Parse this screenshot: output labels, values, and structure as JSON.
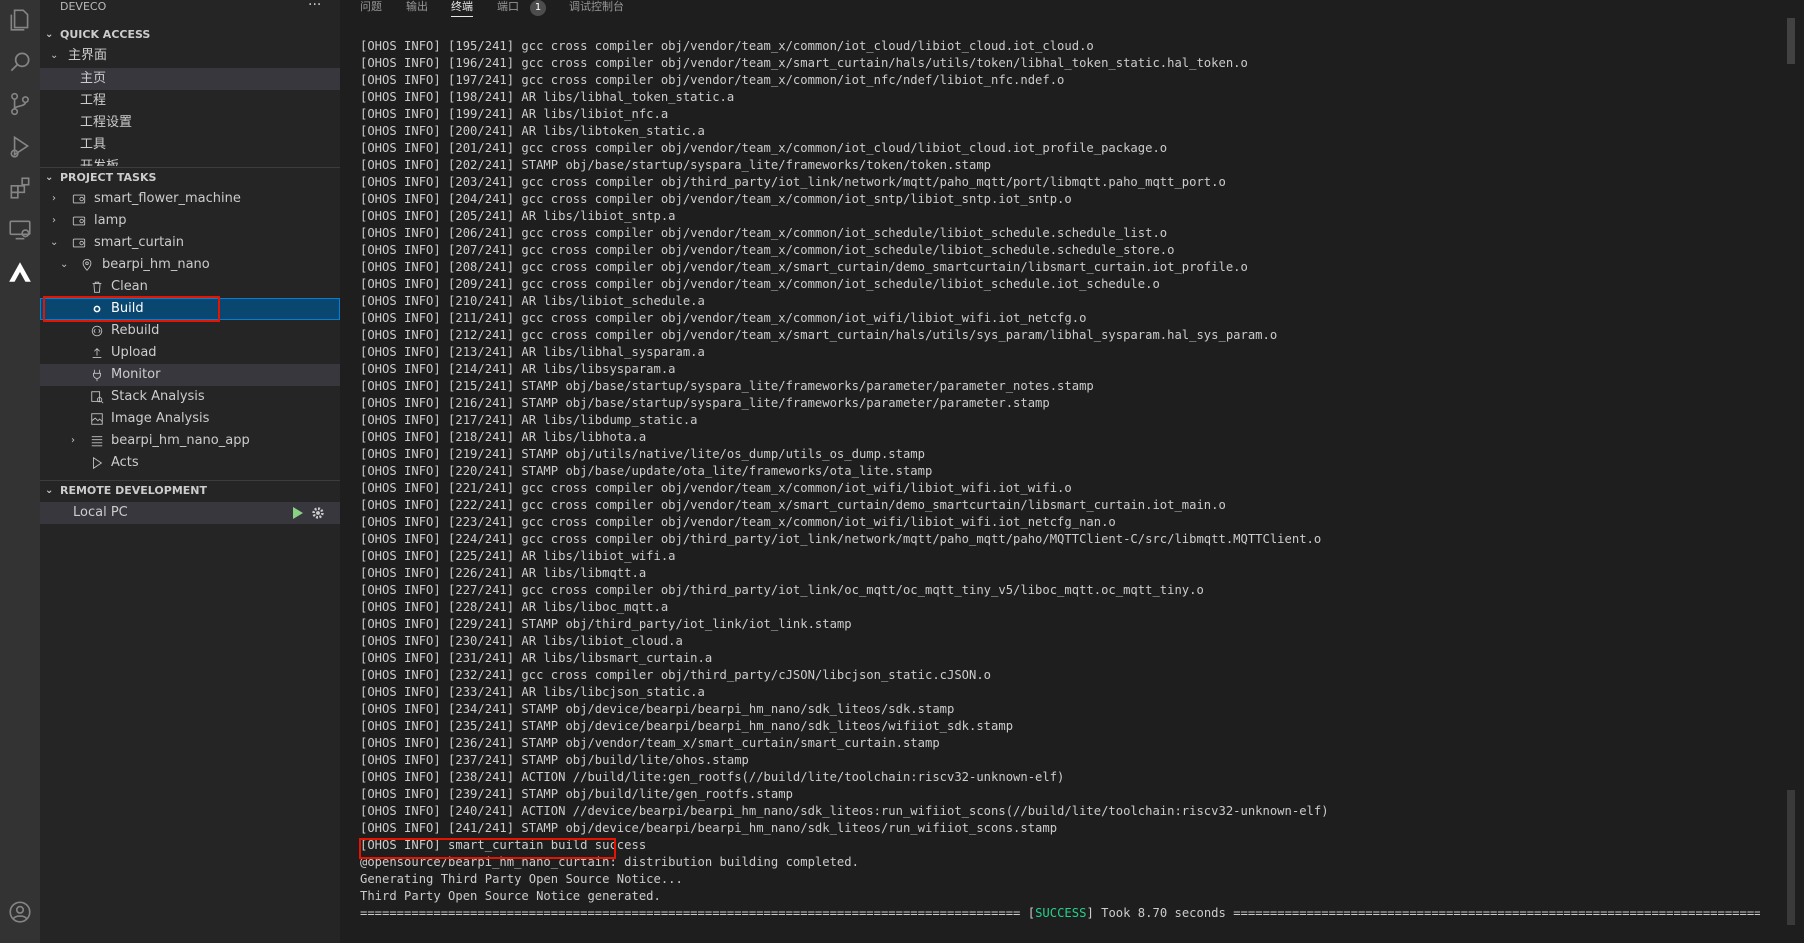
{
  "activity_bar": {
    "icons": [
      "explorer-icon",
      "search-icon",
      "source-control-icon",
      "run-debug-icon",
      "extensions-icon",
      "remote-explorer-icon",
      "deveco-icon",
      "account-icon"
    ]
  },
  "sidebar": {
    "title": "DEVECO",
    "quick_access": {
      "header": "QUICK ACCESS",
      "group": "主界面",
      "items": [
        "主页",
        "工程",
        "工程设置",
        "工具",
        "开发板"
      ]
    },
    "project_tasks": {
      "header": "PROJECT TASKS",
      "projects": [
        "smart_flower_machine",
        "lamp",
        "smart_curtain"
      ],
      "target": "bearpi_hm_nano",
      "tasks": [
        "Clean",
        "Build",
        "Rebuild",
        "Upload",
        "Monitor",
        "Stack Analysis",
        "Image Analysis",
        "bearpi_hm_nano_app",
        "Acts"
      ]
    },
    "remote_development": {
      "header": "REMOTE DEVELOPMENT",
      "item": "Local PC"
    }
  },
  "panel": {
    "tabs": [
      "问题",
      "输出",
      "终端",
      "端口",
      "调试控制台"
    ],
    "active_tab": "终端",
    "ports_badge": "1"
  },
  "terminal": {
    "lines": [
      "[OHOS INFO] [195/241] gcc cross compiler obj/vendor/team_x/common/iot_cloud/libiot_cloud.iot_cloud.o",
      "[OHOS INFO] [196/241] gcc cross compiler obj/vendor/team_x/smart_curtain/hals/utils/token/libhal_token_static.hal_token.o",
      "[OHOS INFO] [197/241] gcc cross compiler obj/vendor/team_x/common/iot_nfc/ndef/libiot_nfc.ndef.o",
      "[OHOS INFO] [198/241] AR libs/libhal_token_static.a",
      "[OHOS INFO] [199/241] AR libs/libiot_nfc.a",
      "[OHOS INFO] [200/241] AR libs/libtoken_static.a",
      "[OHOS INFO] [201/241] gcc cross compiler obj/vendor/team_x/common/iot_cloud/libiot_cloud.iot_profile_package.o",
      "[OHOS INFO] [202/241] STAMP obj/base/startup/syspara_lite/frameworks/token/token.stamp",
      "[OHOS INFO] [203/241] gcc cross compiler obj/third_party/iot_link/network/mqtt/paho_mqtt/port/libmqtt.paho_mqtt_port.o",
      "[OHOS INFO] [204/241] gcc cross compiler obj/vendor/team_x/common/iot_sntp/libiot_sntp.iot_sntp.o",
      "[OHOS INFO] [205/241] AR libs/libiot_sntp.a",
      "[OHOS INFO] [206/241] gcc cross compiler obj/vendor/team_x/common/iot_schedule/libiot_schedule.schedule_list.o",
      "[OHOS INFO] [207/241] gcc cross compiler obj/vendor/team_x/common/iot_schedule/libiot_schedule.schedule_store.o",
      "[OHOS INFO] [208/241] gcc cross compiler obj/vendor/team_x/smart_curtain/demo_smartcurtain/libsmart_curtain.iot_profile.o",
      "[OHOS INFO] [209/241] gcc cross compiler obj/vendor/team_x/common/iot_schedule/libiot_schedule.iot_schedule.o",
      "[OHOS INFO] [210/241] AR libs/libiot_schedule.a",
      "[OHOS INFO] [211/241] gcc cross compiler obj/vendor/team_x/common/iot_wifi/libiot_wifi.iot_netcfg.o",
      "[OHOS INFO] [212/241] gcc cross compiler obj/vendor/team_x/smart_curtain/hals/utils/sys_param/libhal_sysparam.hal_sys_param.o",
      "[OHOS INFO] [213/241] AR libs/libhal_sysparam.a",
      "[OHOS INFO] [214/241] AR libs/libsysparam.a",
      "[OHOS INFO] [215/241] STAMP obj/base/startup/syspara_lite/frameworks/parameter/parameter_notes.stamp",
      "[OHOS INFO] [216/241] STAMP obj/base/startup/syspara_lite/frameworks/parameter/parameter.stamp",
      "[OHOS INFO] [217/241] AR libs/libdump_static.a",
      "[OHOS INFO] [218/241] AR libs/libhota.a",
      "[OHOS INFO] [219/241] STAMP obj/utils/native/lite/os_dump/utils_os_dump.stamp",
      "[OHOS INFO] [220/241] STAMP obj/base/update/ota_lite/frameworks/ota_lite.stamp",
      "[OHOS INFO] [221/241] gcc cross compiler obj/vendor/team_x/common/iot_wifi/libiot_wifi.iot_wifi.o",
      "[OHOS INFO] [222/241] gcc cross compiler obj/vendor/team_x/smart_curtain/demo_smartcurtain/libsmart_curtain.iot_main.o",
      "[OHOS INFO] [223/241] gcc cross compiler obj/vendor/team_x/common/iot_wifi/libiot_wifi.iot_netcfg_nan.o",
      "[OHOS INFO] [224/241] gcc cross compiler obj/third_party/iot_link/network/mqtt/paho_mqtt/paho/MQTTClient-C/src/libmqtt.MQTTClient.o",
      "[OHOS INFO] [225/241] AR libs/libiot_wifi.a",
      "[OHOS INFO] [226/241] AR libs/libmqtt.a",
      "[OHOS INFO] [227/241] gcc cross compiler obj/third_party/iot_link/oc_mqtt/oc_mqtt_tiny_v5/liboc_mqtt.oc_mqtt_tiny.o",
      "[OHOS INFO] [228/241] AR libs/liboc_mqtt.a",
      "[OHOS INFO] [229/241] STAMP obj/third_party/iot_link/iot_link.stamp",
      "[OHOS INFO] [230/241] AR libs/libiot_cloud.a",
      "[OHOS INFO] [231/241] AR libs/libsmart_curtain.a",
      "[OHOS INFO] [232/241] gcc cross compiler obj/third_party/cJSON/libcjson_static.cJSON.o",
      "[OHOS INFO] [233/241] AR libs/libcjson_static.a",
      "[OHOS INFO] [234/241] STAMP obj/device/bearpi/bearpi_hm_nano/sdk_liteos/sdk.stamp",
      "[OHOS INFO] [235/241] STAMP obj/device/bearpi/bearpi_hm_nano/sdk_liteos/wifiiot_sdk.stamp",
      "[OHOS INFO] [236/241] STAMP obj/vendor/team_x/smart_curtain/smart_curtain.stamp",
      "[OHOS INFO] [237/241] STAMP obj/build/lite/ohos.stamp",
      "[OHOS INFO] [238/241] ACTION //build/lite:gen_rootfs(//build/lite/toolchain:riscv32-unknown-elf)",
      "[OHOS INFO] [239/241] STAMP obj/build/lite/gen_rootfs.stamp",
      "[OHOS INFO] [240/241] ACTION //device/bearpi/bearpi_hm_nano/sdk_liteos:run_wifiiot_scons(//build/lite/toolchain:riscv32-unknown-elf)",
      "[OHOS INFO] [241/241] STAMP obj/device/bearpi/bearpi_hm_nano/sdk_liteos/run_wifiiot_scons.stamp",
      "[OHOS INFO] smart_curtain build success",
      "@opensource/bearpi_hm_nano_curtain: distribution building completed.",
      "Generating Third Party Open Source Notice...",
      "Third Party Open Source Notice generated."
    ],
    "summary": {
      "left_rule": "==========================================================================================",
      "status": "SUCCESS",
      "took": "Took 8.70 seconds",
      "right_rule": "=========================================================================================="
    }
  },
  "colors": {
    "accent": "#007fd4",
    "selection": "#094771",
    "highlight_box": "#e51400",
    "success": "#23d18b"
  }
}
